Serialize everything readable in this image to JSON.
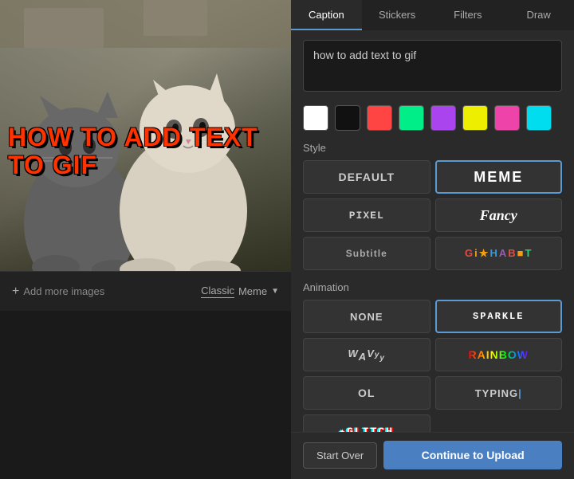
{
  "tabs": [
    {
      "label": "Caption",
      "active": true
    },
    {
      "label": "Stickers",
      "active": false
    },
    {
      "label": "Filters",
      "active": false
    },
    {
      "label": "Draw",
      "active": false
    }
  ],
  "caption": {
    "text_input": "how to add text to gif",
    "text_placeholder": "how to add text to gif",
    "colors": [
      {
        "name": "white",
        "hex": "#ffffff",
        "selected": false
      },
      {
        "name": "black",
        "hex": "#000000",
        "selected": false
      },
      {
        "name": "red",
        "hex": "#ff4444",
        "selected": false
      },
      {
        "name": "green",
        "hex": "#00ee88",
        "selected": false
      },
      {
        "name": "purple",
        "hex": "#aa44ee",
        "selected": false
      },
      {
        "name": "yellow",
        "hex": "#eeee00",
        "selected": false
      },
      {
        "name": "pink",
        "hex": "#ee44aa",
        "selected": false
      },
      {
        "name": "cyan",
        "hex": "#00ddee",
        "selected": false
      }
    ]
  },
  "style_section_label": "Style",
  "styles": [
    {
      "id": "default",
      "label": "DEFAULT",
      "active": false
    },
    {
      "id": "meme",
      "label": "MEME",
      "active": true
    },
    {
      "id": "pixel",
      "label": "PIXEL",
      "active": false
    },
    {
      "id": "fancy",
      "label": "Fancy",
      "active": false
    },
    {
      "id": "subtitle",
      "label": "Subtitle",
      "active": false
    },
    {
      "id": "alphabet",
      "label": "GiHABET",
      "active": false
    }
  ],
  "animation_section_label": "Animation",
  "animations": [
    {
      "id": "none",
      "label": "NONE",
      "active": false
    },
    {
      "id": "sparkle",
      "label": "SPARKLE",
      "active": true
    },
    {
      "id": "wavy",
      "label": "WAVyy",
      "active": false
    },
    {
      "id": "rainbow",
      "label": "RAINBOW",
      "active": false
    },
    {
      "id": "ol",
      "label": "OL",
      "active": false
    },
    {
      "id": "typing",
      "label": "TYPING",
      "active": false
    },
    {
      "id": "glitch",
      "label": "GLITCH",
      "active": false
    }
  ],
  "gif_overlay_text": "HOW TO ADD TEXT TO GIF",
  "bottom_bar": {
    "add_more": "Add more images",
    "style_classic": "Classic",
    "style_meme": "Meme"
  },
  "buttons": {
    "start_over": "Start Over",
    "continue": "Continue to Upload"
  }
}
